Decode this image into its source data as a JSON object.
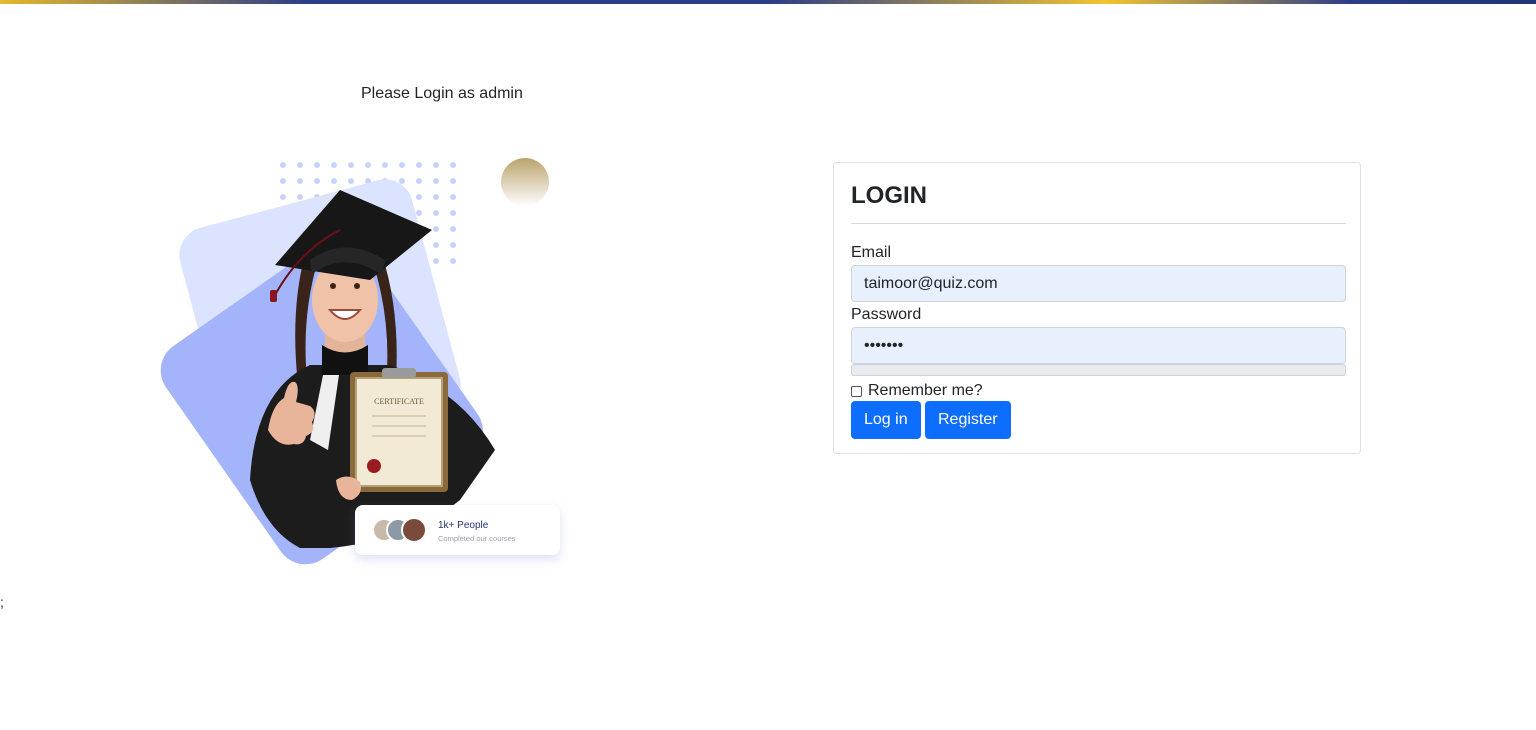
{
  "page": {
    "instruction": "Please Login as admin",
    "stray_text": ";"
  },
  "hero": {
    "badge_title": "1k+ People",
    "badge_subtitle": "Completed our courses",
    "certificate_text": "CERTIFICATE"
  },
  "login": {
    "title": "LOGIN",
    "email_label": "Email",
    "email_value": "taimoor@quiz.com",
    "password_label": "Password",
    "password_value": "•••••••",
    "strength_fraction": 0,
    "remember_label": "Remember me?",
    "remember_checked": false,
    "login_button": "Log in",
    "register_button": "Register"
  },
  "colors": {
    "primary": "#0d6efd",
    "input_bg": "#e8f0fe",
    "hero_light": "#dbe3ff",
    "hero_mid": "#a4b4fb",
    "gold": "#c7b07a"
  }
}
